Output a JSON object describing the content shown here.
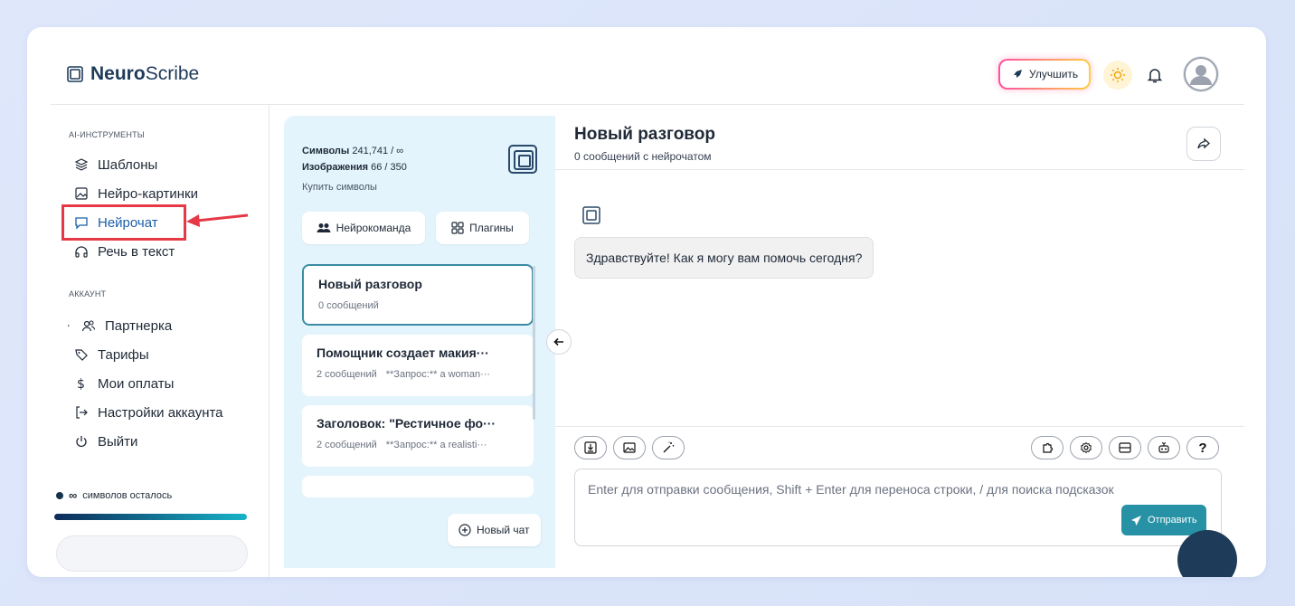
{
  "app": {
    "logo_bold": "Neuro",
    "logo_rest": "Scribe"
  },
  "header": {
    "upgrade_label": "Улучшить"
  },
  "sidebar": {
    "tools_label": "AI-ИНСТРУМЕНТЫ",
    "tools": [
      {
        "label": "Шаблоны",
        "icon": "layers-icon"
      },
      {
        "label": "Нейро-картинки",
        "icon": "image-icon"
      },
      {
        "label": "Нейрочат",
        "icon": "chat-icon",
        "active": true
      },
      {
        "label": "Речь в текст",
        "icon": "headphones-icon"
      }
    ],
    "account_label": "АККАУНТ",
    "account": [
      {
        "label": "Партнерка",
        "icon": "users-icon"
      },
      {
        "label": "Тарифы",
        "icon": "tag-icon"
      },
      {
        "label": "Мои оплаты",
        "icon": "dollar-icon"
      },
      {
        "label": "Настройки аккаунта",
        "icon": "logout-arrow-icon"
      },
      {
        "label": "Выйти",
        "icon": "power-icon"
      }
    ],
    "symbols_prefix": "∞",
    "symbols_text": "символов осталось",
    "highlight_color": "#e63946"
  },
  "panel": {
    "symbols_label": "Символы",
    "symbols_value": "241,741 / ∞",
    "images_label": "Изображения",
    "images_value": "66 / 350",
    "buy_label": "Купить символы",
    "team_btn": "Нейрокоманда",
    "plugins_btn": "Плагины",
    "chats": [
      {
        "title": "Новый разговор",
        "count": "0 сообщений",
        "preview": ""
      },
      {
        "title": "Помощник создает макия···",
        "count": "2 сообщений",
        "preview": "**Запрос:** a woman···"
      },
      {
        "title": "Заголовок: \"Рестичное фо···",
        "count": "2 сообщений",
        "preview": "**Запрос:** a realisti···"
      }
    ],
    "new_chat_label": "Новый чат"
  },
  "chat": {
    "title": "Новый разговор",
    "subtitle": "0 сообщений с нейрочатом",
    "greeting": "Здравствуйте! Как я могу вам помочь сегодня?",
    "placeholder": "Enter для отправки сообщения, Shift + Enter для переноса строки, / для поиска подсказок",
    "send_label": "Отправить",
    "help_label": "?",
    "accent": "#2792a6"
  }
}
